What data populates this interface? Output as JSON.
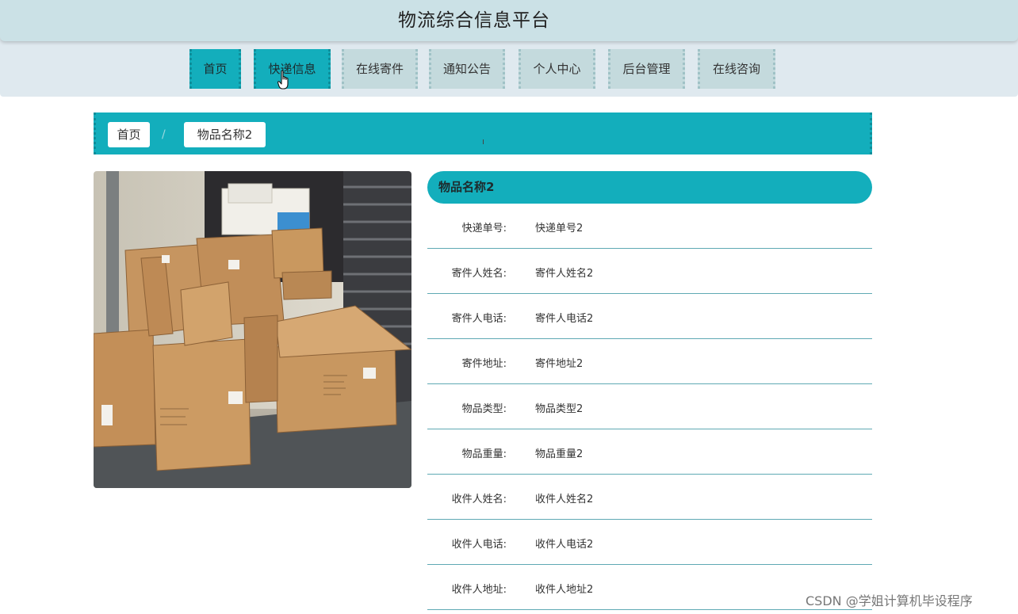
{
  "site": {
    "title": "物流综合信息平台"
  },
  "nav": {
    "items": [
      {
        "label": "首页",
        "active": true
      },
      {
        "label": "快递信息",
        "active": true
      },
      {
        "label": "在线寄件",
        "active": false
      },
      {
        "label": "通知公告",
        "active": false
      },
      {
        "label": "个人中心",
        "active": false
      },
      {
        "label": "后台管理",
        "active": false
      },
      {
        "label": "在线咨询",
        "active": false
      }
    ]
  },
  "breadcrumb": {
    "home": "首页",
    "separator": "/",
    "current": "物品名称2"
  },
  "detail": {
    "title": "物品名称2",
    "fields": [
      {
        "label": "快递单号:",
        "value": "快递单号2"
      },
      {
        "label": "寄件人姓名:",
        "value": "寄件人姓名2"
      },
      {
        "label": "寄件人电话:",
        "value": "寄件人电话2"
      },
      {
        "label": "寄件地址:",
        "value": "寄件地址2"
      },
      {
        "label": "物品类型:",
        "value": "物品类型2"
      },
      {
        "label": "物品重量:",
        "value": "物品重量2"
      },
      {
        "label": "收件人姓名:",
        "value": "收件人姓名2"
      },
      {
        "label": "收件人电话:",
        "value": "收件人电话2"
      },
      {
        "label": "收件人地址:",
        "value": "收件人地址2"
      }
    ]
  },
  "watermark": "CSDN @学姐计算机毕设程序",
  "colors": {
    "accent": "#13aebc",
    "header": "#cbe1e6",
    "nav_bg": "#dfe9ef",
    "tab": "#c4dadd"
  },
  "icons": [
    "hand-pointer-icon",
    "cardboard-boxes-photo"
  ]
}
